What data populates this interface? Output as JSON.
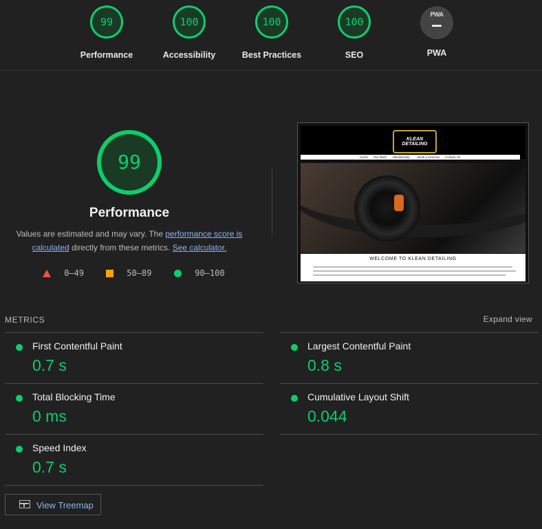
{
  "categories": [
    {
      "label": "Performance",
      "score": "99"
    },
    {
      "label": "Accessibility",
      "score": "100"
    },
    {
      "label": "Best Practices",
      "score": "100"
    },
    {
      "label": "SEO",
      "score": "100"
    },
    {
      "label": "PWA",
      "badge": "PWA"
    }
  ],
  "summary": {
    "score": "99",
    "title": "Performance",
    "desc_pre": "Values are estimated and may vary. The ",
    "desc_link": "performance score is calculated",
    "desc_mid": " directly from these metrics. ",
    "desc_link2": "See calculator."
  },
  "legend": [
    {
      "range": "0–49",
      "color": "#ff4e42"
    },
    {
      "range": "50–89",
      "color": "#ffa400"
    },
    {
      "range": "90–100",
      "color": "#0cce6b"
    }
  ],
  "screenshot": {
    "logo_text": "KLEAN DETAILING",
    "nav": [
      "Home",
      "Our Work",
      "Membership",
      "Book a Services",
      "Contact Us"
    ],
    "welcome": "WELCOME TO KLEAN DETAILING"
  },
  "metrics": {
    "heading": "METRICS",
    "expand": "Expand view",
    "items": [
      {
        "name": "First Contentful Paint",
        "value": "0.7 s"
      },
      {
        "name": "Largest Contentful Paint",
        "value": "0.8 s"
      },
      {
        "name": "Total Blocking Time",
        "value": "0 ms"
      },
      {
        "name": "Cumulative Layout Shift",
        "value": "0.044"
      },
      {
        "name": "Speed Index",
        "value": "0.7 s"
      }
    ]
  },
  "treemap": {
    "label": "View Treemap"
  },
  "colors": {
    "pass": "#0cce6b",
    "link": "#8ab4f8",
    "background": "#212121"
  }
}
